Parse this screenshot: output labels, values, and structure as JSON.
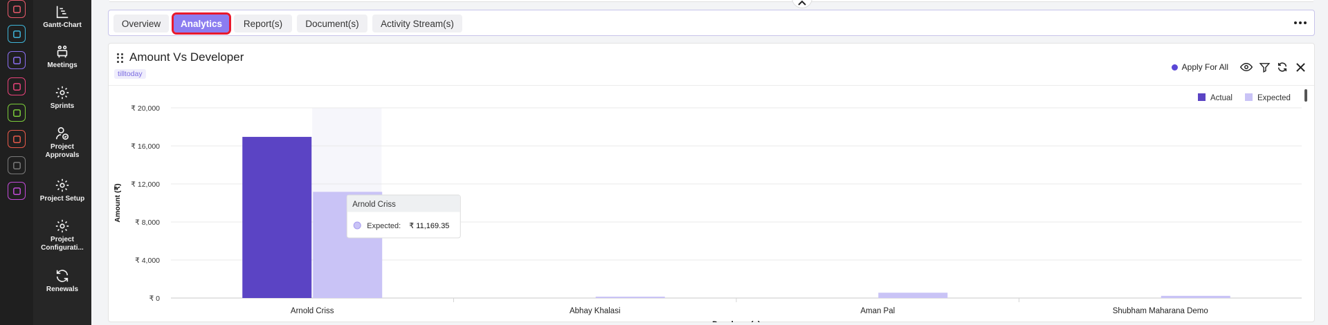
{
  "sidebar": {
    "items": [
      {
        "label": "Gantt-Chart",
        "icon": "gantt-chart-icon"
      },
      {
        "label": "Meetings",
        "icon": "meetings-icon"
      },
      {
        "label": "Sprints",
        "icon": "gear-icon"
      },
      {
        "label": "Project Approvals",
        "icon": "user-approval-icon"
      },
      {
        "label": "Project Setup",
        "icon": "gear-icon"
      },
      {
        "label": "Project Configurati...",
        "icon": "gear-icon"
      },
      {
        "label": "Renewals",
        "icon": "refresh-icon"
      }
    ]
  },
  "rail": {
    "icons": [
      {
        "name": "target-icon",
        "color": "#e85a6b"
      },
      {
        "name": "calendar-icon",
        "color": "#3fb4d8"
      },
      {
        "name": "rocket-icon",
        "color": "#8b6ff0"
      },
      {
        "name": "presentation-icon",
        "color": "#e8437a"
      },
      {
        "name": "document-icon",
        "color": "#7ccc3a"
      },
      {
        "name": "person-flag-icon",
        "color": "#e85a4a"
      },
      {
        "name": "home-icon",
        "color": "#7a7a7a"
      },
      {
        "name": "settings-icon",
        "color": "#c24bd8"
      }
    ]
  },
  "tabs": [
    {
      "label": "Overview",
      "active": false
    },
    {
      "label": "Analytics",
      "active": true
    },
    {
      "label": "Report(s)",
      "active": false
    },
    {
      "label": "Document(s)",
      "active": false
    },
    {
      "label": "Activity Stream(s)",
      "active": false
    }
  ],
  "widget": {
    "title": "Amount Vs Developer",
    "filter_chip": "tilltoday",
    "apply_label": "Apply For All"
  },
  "colors": {
    "actual": "#5b44c4",
    "expected": "#c9c3f6",
    "accent": "#8b7df0",
    "highlight": "#e8192c"
  },
  "tooltip": {
    "title": "Arnold Criss",
    "label": "Expected:",
    "value": "₹ 11,169.35"
  },
  "chart_data": {
    "type": "bar",
    "xlabel": "Developer(s)",
    "ylabel": "Amount (₹)",
    "ylim": [
      0,
      20000
    ],
    "yticks": [
      0,
      4000,
      8000,
      12000,
      16000,
      20000
    ],
    "ytick_labels": [
      "₹ 0",
      "₹ 4,000",
      "₹ 8,000",
      "₹ 12,000",
      "₹ 16,000",
      "₹ 20,000"
    ],
    "categories": [
      "Arnold Criss",
      "Abhay Khalasi",
      "Aman Pal",
      "Shubham Maharana Demo"
    ],
    "legend_position": "top-right",
    "series": [
      {
        "name": "Actual",
        "values": [
          16950,
          0,
          0,
          0
        ]
      },
      {
        "name": "Expected",
        "values": [
          11169.35,
          120,
          560,
          230
        ]
      }
    ]
  }
}
